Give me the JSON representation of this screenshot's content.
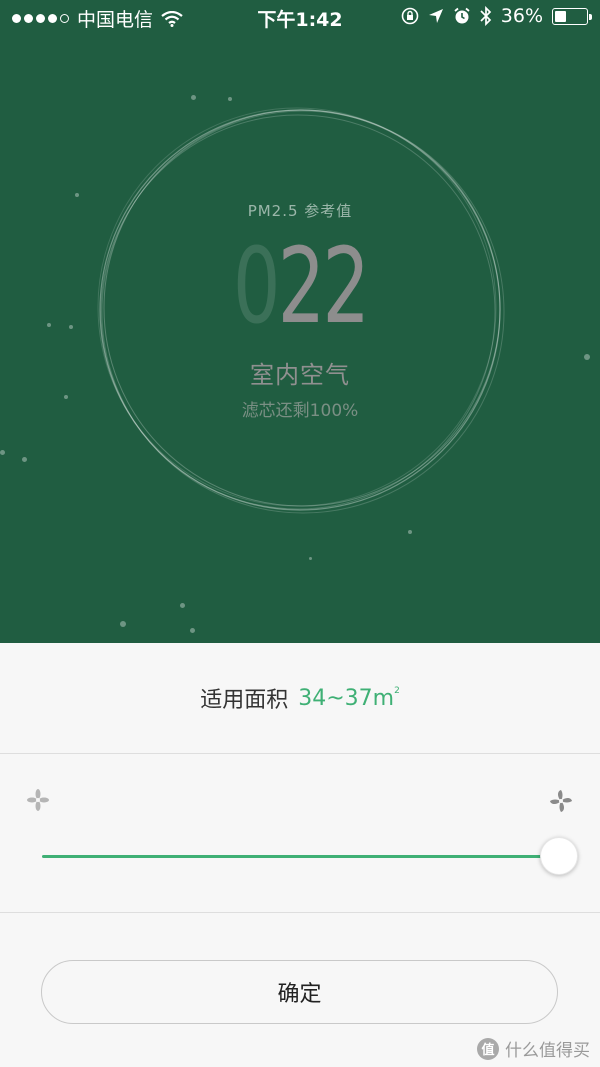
{
  "status_bar": {
    "carrier": "中国电信",
    "time": "下午1:42",
    "battery": "36%",
    "battery_level": 0.36
  },
  "display": {
    "pm_label": "PM2.5 参考值",
    "pm_leading_digit": "0",
    "pm_value": "22",
    "room_label": "室内空气",
    "filter_status": "滤芯还剩100%"
  },
  "area": {
    "label": "适用面积",
    "value": "34~37m",
    "unit_superscript": "2"
  },
  "fan_speed": {
    "level": 1.0
  },
  "confirm_label": "确定",
  "watermark": {
    "icon_text": "值",
    "text": "什么值得买"
  },
  "colors": {
    "background_green": "#205d41",
    "accent_green": "#3fb075"
  }
}
